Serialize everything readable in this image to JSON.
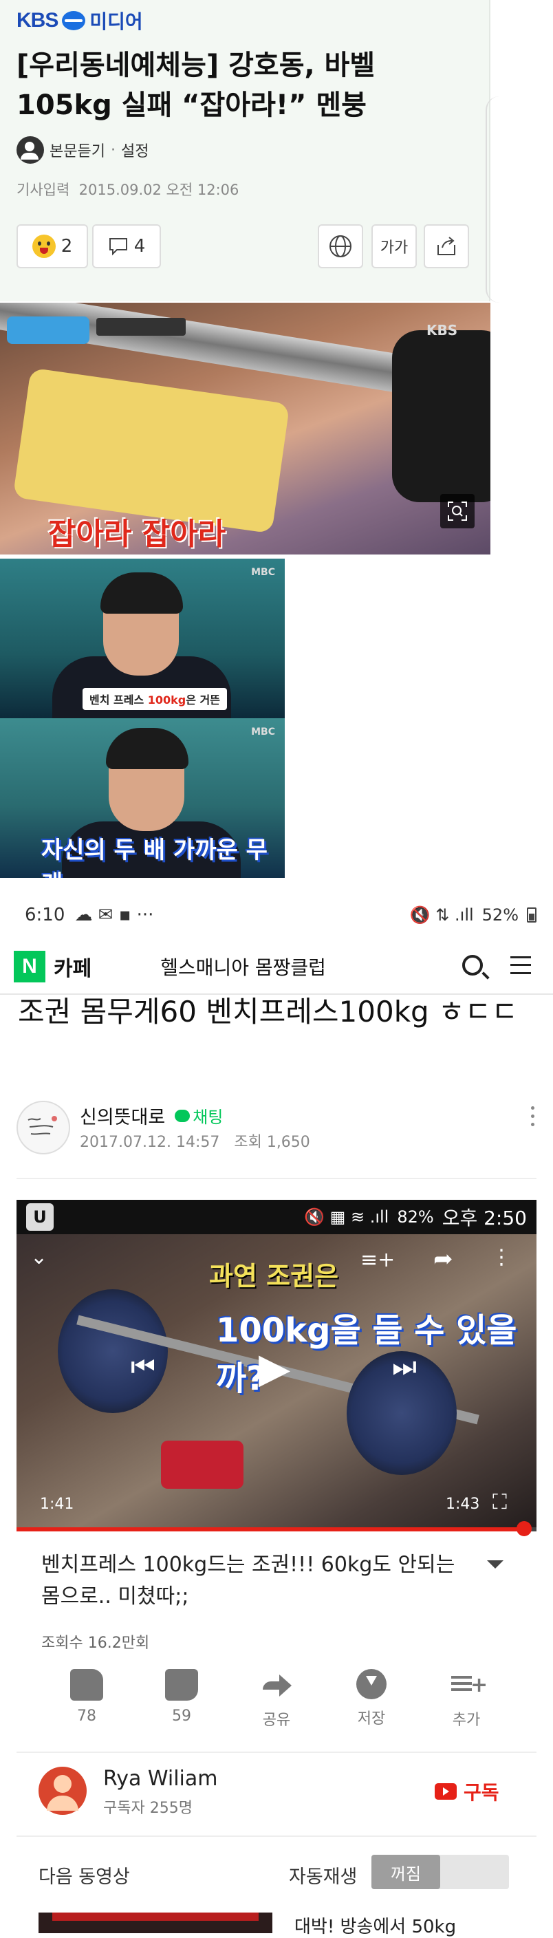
{
  "article": {
    "brand_kbs": "KBS",
    "brand_media": "미디어",
    "headline": "[우리동네예체능] 강호동, 바벨 105kg 실패 “잡아라!” 멘붕",
    "listen": "본문듣기",
    "settings": "설정",
    "date_label": "기사입력",
    "date": "2015.09.02 오전 12:06",
    "reaction_count": "2",
    "comment_count": "4",
    "font_btn": "가가"
  },
  "images": {
    "photo1_caption": "잡아라 잡아라",
    "photo1_watermark": "KBS",
    "photo2_caption_pre": "벤치 프레스 ",
    "photo2_caption_hl": "100kg",
    "photo2_caption_post": "은 거뜬",
    "photo2_watermark": "MBC",
    "photo3_caption": "자신의 두 배 가까운 무게",
    "photo3_watermark": "MBC"
  },
  "statusbar": {
    "time": "6:10",
    "battery": "52%"
  },
  "cafe": {
    "logo": "N",
    "label": "카페",
    "club_name": "헬스매니아 몸짱클럽",
    "post_title": "조권 몸무게60 벤치프레스100kg ㅎㄷㄷ",
    "author": "신의뜻대로",
    "chat": "채팅",
    "post_date": "2017.07.12. 14:57",
    "views": "조회 1,650"
  },
  "youtube": {
    "status_time": "오후 2:50",
    "status_battery": "82%",
    "caption_top": "과연 조권은",
    "caption_main": "100kg을 들 수 있을까?",
    "time_current": "1:41",
    "time_total": "1:43",
    "progress_fraction": 0.976,
    "title": "벤치프레스 100kg드는 조권!!! 60kg도 안되는 몸으로.. 미쳤따;;",
    "views": "조회수 16.2만회",
    "actions": [
      {
        "label": "78",
        "icon": "thumbs-up-icon"
      },
      {
        "label": "59",
        "icon": "thumbs-down-icon"
      },
      {
        "label": "공유",
        "icon": "share-icon"
      },
      {
        "label": "저장",
        "icon": "save-icon"
      },
      {
        "label": "추가",
        "icon": "add-to-playlist-icon"
      }
    ],
    "channel_name": "Rya Wiliam",
    "channel_subs": "구독자 255명",
    "subscribe": "구독",
    "next_label": "다음 동영상",
    "autoplay_label": "자동재생",
    "autoplay_state": "꺼짐",
    "next_title": "대박! 방송에서 50kg"
  },
  "colors": {
    "kbs_blue": "#1b4bb7",
    "naver_green": "#03c75a",
    "youtube_red": "#e62117"
  }
}
